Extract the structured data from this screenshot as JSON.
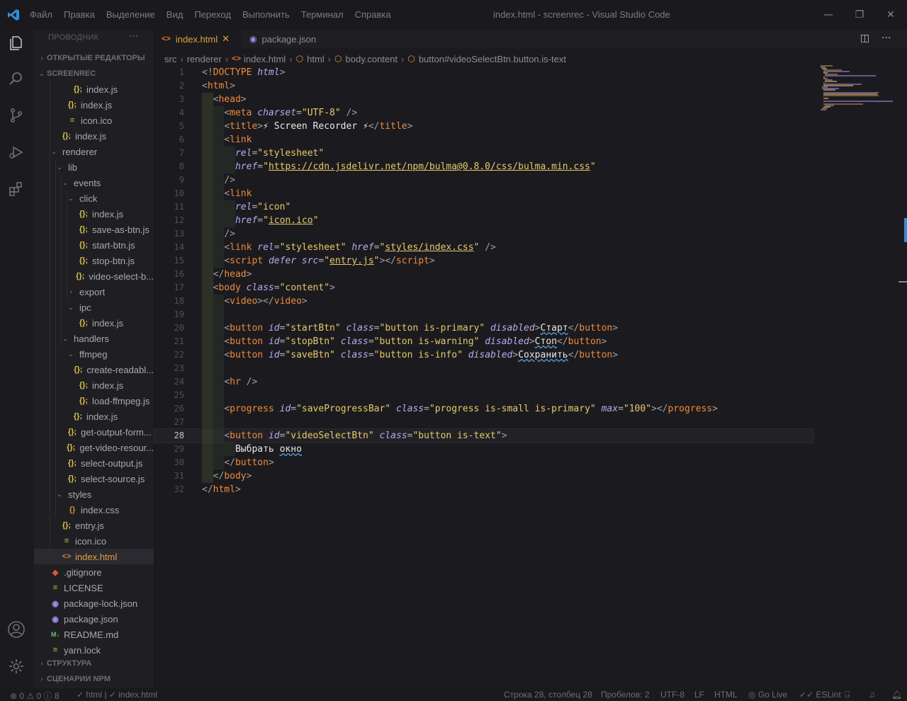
{
  "window": {
    "menu": [
      "Файл",
      "Правка",
      "Выделение",
      "Вид",
      "Переход",
      "Выполнить",
      "Терминал",
      "Справка"
    ],
    "title": "index.html - screenrec - Visual Studio Code"
  },
  "sidebar": {
    "header": "ПРОВОДНИК",
    "more": "···",
    "open_editors": "ОТКРЫТЫЕ РЕДАКТОРЫ",
    "project": "SCREENREC",
    "outline": "СТРУКТУРА",
    "npm_scripts": "СЦЕНАРИИ NPM",
    "tree": [
      {
        "label": "index.js",
        "icon": "js",
        "depth": 5,
        "chev": ""
      },
      {
        "label": "index.js",
        "icon": "js",
        "depth": 4,
        "chev": ""
      },
      {
        "label": "icon.ico",
        "icon": "ico",
        "depth": 4,
        "chev": ""
      },
      {
        "label": "index.js",
        "icon": "js",
        "depth": 3,
        "chev": ""
      },
      {
        "label": "renderer",
        "icon": "",
        "depth": 2,
        "chev": "▾"
      },
      {
        "label": "lib",
        "icon": "",
        "depth": 3,
        "chev": "▾"
      },
      {
        "label": "events",
        "icon": "",
        "depth": 4,
        "chev": "▾"
      },
      {
        "label": "click",
        "icon": "",
        "depth": 5,
        "chev": "▾"
      },
      {
        "label": "index.js",
        "icon": "js",
        "depth": 6,
        "chev": ""
      },
      {
        "label": "save-as-btn.js",
        "icon": "js",
        "depth": 6,
        "chev": ""
      },
      {
        "label": "start-btn.js",
        "icon": "js",
        "depth": 6,
        "chev": ""
      },
      {
        "label": "stop-btn.js",
        "icon": "js",
        "depth": 6,
        "chev": ""
      },
      {
        "label": "video-select-b...",
        "icon": "js",
        "depth": 6,
        "chev": ""
      },
      {
        "label": "export",
        "icon": "",
        "depth": 5,
        "chev": "›"
      },
      {
        "label": "ipc",
        "icon": "",
        "depth": 5,
        "chev": "▾"
      },
      {
        "label": "index.js",
        "icon": "js",
        "depth": 6,
        "chev": ""
      },
      {
        "label": "handlers",
        "icon": "",
        "depth": 4,
        "chev": "▾"
      },
      {
        "label": "ffmpeg",
        "icon": "",
        "depth": 5,
        "chev": "▾"
      },
      {
        "label": "create-readabl...",
        "icon": "js",
        "depth": 6,
        "chev": ""
      },
      {
        "label": "index.js",
        "icon": "js",
        "depth": 6,
        "chev": ""
      },
      {
        "label": "load-ffmpeg.js",
        "icon": "js",
        "depth": 6,
        "chev": ""
      },
      {
        "label": "index.js",
        "icon": "js",
        "depth": 5,
        "chev": ""
      },
      {
        "label": "get-output-form...",
        "icon": "js",
        "depth": 4,
        "chev": ""
      },
      {
        "label": "get-video-resour...",
        "icon": "js",
        "depth": 4,
        "chev": ""
      },
      {
        "label": "select-output.js",
        "icon": "js",
        "depth": 4,
        "chev": ""
      },
      {
        "label": "select-source.js",
        "icon": "js",
        "depth": 4,
        "chev": ""
      },
      {
        "label": "styles",
        "icon": "",
        "depth": 3,
        "chev": "▾"
      },
      {
        "label": "index.css",
        "icon": "css",
        "depth": 4,
        "chev": ""
      },
      {
        "label": "entry.js",
        "icon": "js",
        "depth": 3,
        "chev": ""
      },
      {
        "label": "icon.ico",
        "icon": "ico",
        "depth": 3,
        "chev": ""
      },
      {
        "label": "index.html",
        "icon": "html",
        "depth": 3,
        "chev": "",
        "selected": true
      },
      {
        "label": ".gitignore",
        "icon": "git",
        "depth": 1,
        "chev": ""
      },
      {
        "label": "LICENSE",
        "icon": "lic",
        "depth": 1,
        "chev": ""
      },
      {
        "label": "package-lock.json",
        "icon": "json",
        "depth": 1,
        "chev": ""
      },
      {
        "label": "package.json",
        "icon": "json",
        "depth": 1,
        "chev": ""
      },
      {
        "label": "README.md",
        "icon": "md",
        "depth": 1,
        "chev": ""
      },
      {
        "label": "yarn.lock",
        "icon": "lic",
        "depth": 1,
        "chev": ""
      }
    ]
  },
  "tabs": [
    {
      "label": "index.html",
      "active": true,
      "close": "✕"
    },
    {
      "label": "package.json",
      "active": false
    }
  ],
  "breadcrumb": [
    "src",
    "renderer",
    "index.html",
    "html",
    "body.content",
    "button#videoSelectBtn.button.is-text"
  ],
  "editor": {
    "current_line": 28,
    "lines": [
      [
        [
          "br",
          "<!"
        ],
        [
          "tag",
          "DOCTYPE"
        ],
        [
          "t",
          " "
        ],
        [
          "attr",
          "html"
        ],
        [
          "br",
          ">"
        ]
      ],
      [
        [
          "br",
          "<"
        ],
        [
          "tag",
          "html"
        ],
        [
          "br",
          ">"
        ]
      ],
      [
        [
          "i",
          1
        ],
        [
          "br",
          "<"
        ],
        [
          "tag",
          "head"
        ],
        [
          "br",
          ">"
        ]
      ],
      [
        [
          "i",
          2
        ],
        [
          "br",
          "<"
        ],
        [
          "tag",
          "meta"
        ],
        [
          "t",
          " "
        ],
        [
          "attr",
          "charset"
        ],
        [
          "eq",
          "="
        ],
        [
          "str",
          "\"UTF-8\""
        ],
        [
          "t",
          " "
        ],
        [
          "br",
          "/>"
        ]
      ],
      [
        [
          "i",
          2
        ],
        [
          "br",
          "<"
        ],
        [
          "tag",
          "title"
        ],
        [
          "br",
          ">"
        ],
        [
          "text",
          "⚡ Screen Recorder ⚡"
        ],
        [
          "br",
          "</"
        ],
        [
          "tag",
          "title"
        ],
        [
          "br",
          ">"
        ]
      ],
      [
        [
          "i",
          2
        ],
        [
          "br",
          "<"
        ],
        [
          "tag",
          "link"
        ]
      ],
      [
        [
          "i",
          3
        ],
        [
          "attr",
          "rel"
        ],
        [
          "eq",
          "="
        ],
        [
          "str",
          "\"stylesheet\""
        ]
      ],
      [
        [
          "i",
          3
        ],
        [
          "attr",
          "href"
        ],
        [
          "eq",
          "="
        ],
        [
          "str",
          "\""
        ],
        [
          "link",
          "https://cdn.jsdelivr.net/npm/bulma@0.8.0/css/bulma.min.css"
        ],
        [
          "str",
          "\""
        ]
      ],
      [
        [
          "i",
          2
        ],
        [
          "br",
          "/>"
        ]
      ],
      [
        [
          "i",
          2
        ],
        [
          "br",
          "<"
        ],
        [
          "tag",
          "link"
        ]
      ],
      [
        [
          "i",
          3
        ],
        [
          "attr",
          "rel"
        ],
        [
          "eq",
          "="
        ],
        [
          "str",
          "\"icon\""
        ]
      ],
      [
        [
          "i",
          3
        ],
        [
          "attr",
          "href"
        ],
        [
          "eq",
          "="
        ],
        [
          "str",
          "\""
        ],
        [
          "link",
          "icon.ico"
        ],
        [
          "str",
          "\""
        ]
      ],
      [
        [
          "i",
          2
        ],
        [
          "br",
          "/>"
        ]
      ],
      [
        [
          "i",
          2
        ],
        [
          "br",
          "<"
        ],
        [
          "tag",
          "link"
        ],
        [
          "t",
          " "
        ],
        [
          "attr",
          "rel"
        ],
        [
          "eq",
          "="
        ],
        [
          "str",
          "\"stylesheet\""
        ],
        [
          "t",
          " "
        ],
        [
          "attr",
          "href"
        ],
        [
          "eq",
          "="
        ],
        [
          "str",
          "\""
        ],
        [
          "link",
          "styles/index.css"
        ],
        [
          "str",
          "\""
        ],
        [
          "t",
          " "
        ],
        [
          "br",
          "/>"
        ]
      ],
      [
        [
          "i",
          2
        ],
        [
          "br",
          "<"
        ],
        [
          "tag",
          "script"
        ],
        [
          "t",
          " "
        ],
        [
          "attr",
          "defer"
        ],
        [
          "t",
          " "
        ],
        [
          "attr",
          "src"
        ],
        [
          "eq",
          "="
        ],
        [
          "str",
          "\""
        ],
        [
          "link",
          "entry.js"
        ],
        [
          "str",
          "\""
        ],
        [
          "br",
          "></"
        ],
        [
          "tag",
          "script"
        ],
        [
          "br",
          ">"
        ]
      ],
      [
        [
          "i",
          1
        ],
        [
          "br",
          "</"
        ],
        [
          "tag",
          "head"
        ],
        [
          "br",
          ">"
        ]
      ],
      [
        [
          "i",
          1
        ],
        [
          "br",
          "<"
        ],
        [
          "tag",
          "body"
        ],
        [
          "t",
          " "
        ],
        [
          "attr",
          "class"
        ],
        [
          "eq",
          "="
        ],
        [
          "str",
          "\"content\""
        ],
        [
          "br",
          ">"
        ]
      ],
      [
        [
          "i",
          2
        ],
        [
          "br",
          "<"
        ],
        [
          "tag",
          "video"
        ],
        [
          "br",
          "></"
        ],
        [
          "tag",
          "video"
        ],
        [
          "br",
          ">"
        ]
      ],
      [
        [
          "i",
          2
        ]
      ],
      [
        [
          "i",
          2
        ],
        [
          "br",
          "<"
        ],
        [
          "tag",
          "button"
        ],
        [
          "t",
          " "
        ],
        [
          "attr",
          "id"
        ],
        [
          "eq",
          "="
        ],
        [
          "str",
          "\"startBtn\""
        ],
        [
          "t",
          " "
        ],
        [
          "attr",
          "class"
        ],
        [
          "eq",
          "="
        ],
        [
          "str",
          "\"button is-primary\""
        ],
        [
          "t",
          " "
        ],
        [
          "attr",
          "disabled"
        ],
        [
          "br",
          ">"
        ],
        [
          "sq",
          "Старт"
        ],
        [
          "br",
          "</"
        ],
        [
          "tag",
          "button"
        ],
        [
          "br",
          ">"
        ]
      ],
      [
        [
          "i",
          2
        ],
        [
          "br",
          "<"
        ],
        [
          "tag",
          "button"
        ],
        [
          "t",
          " "
        ],
        [
          "attr",
          "id"
        ],
        [
          "eq",
          "="
        ],
        [
          "str",
          "\"stopBtn\""
        ],
        [
          "t",
          " "
        ],
        [
          "attr",
          "class"
        ],
        [
          "eq",
          "="
        ],
        [
          "str",
          "\"button is-warning\""
        ],
        [
          "t",
          " "
        ],
        [
          "attr",
          "disabled"
        ],
        [
          "br",
          ">"
        ],
        [
          "sq",
          "Стоп"
        ],
        [
          "br",
          "</"
        ],
        [
          "tag",
          "button"
        ],
        [
          "br",
          ">"
        ]
      ],
      [
        [
          "i",
          2
        ],
        [
          "br",
          "<"
        ],
        [
          "tag",
          "button"
        ],
        [
          "t",
          " "
        ],
        [
          "attr",
          "id"
        ],
        [
          "eq",
          "="
        ],
        [
          "str",
          "\"saveBtn\""
        ],
        [
          "t",
          " "
        ],
        [
          "attr",
          "class"
        ],
        [
          "eq",
          "="
        ],
        [
          "str",
          "\"button is-info\""
        ],
        [
          "t",
          " "
        ],
        [
          "attr",
          "disabled"
        ],
        [
          "br",
          ">"
        ],
        [
          "sq",
          "Сохранить"
        ],
        [
          "br",
          "</"
        ],
        [
          "tag",
          "button"
        ],
        [
          "br",
          ">"
        ]
      ],
      [
        [
          "i",
          2
        ]
      ],
      [
        [
          "i",
          2
        ],
        [
          "br",
          "<"
        ],
        [
          "tag",
          "hr"
        ],
        [
          "t",
          " "
        ],
        [
          "br",
          "/>"
        ]
      ],
      [
        [
          "i",
          2
        ]
      ],
      [
        [
          "i",
          2
        ],
        [
          "br",
          "<"
        ],
        [
          "tag",
          "progress"
        ],
        [
          "t",
          " "
        ],
        [
          "attr",
          "id"
        ],
        [
          "eq",
          "="
        ],
        [
          "str",
          "\"saveProgressBar\""
        ],
        [
          "t",
          " "
        ],
        [
          "attr",
          "class"
        ],
        [
          "eq",
          "="
        ],
        [
          "str",
          "\"progress is-small is-primary\""
        ],
        [
          "t",
          " "
        ],
        [
          "attr",
          "max"
        ],
        [
          "eq",
          "="
        ],
        [
          "str",
          "\"100\""
        ],
        [
          "br",
          "></"
        ],
        [
          "tag",
          "progress"
        ],
        [
          "br",
          ">"
        ]
      ],
      [
        [
          "i",
          2
        ]
      ],
      [
        [
          "i",
          2
        ],
        [
          "br",
          "<"
        ],
        [
          "tag",
          "button"
        ],
        [
          "t",
          " "
        ],
        [
          "attr",
          "id"
        ],
        [
          "eq",
          "="
        ],
        [
          "str",
          "\"videoSelectBtn\""
        ],
        [
          "t",
          " "
        ],
        [
          "attr",
          "class"
        ],
        [
          "eq",
          "="
        ],
        [
          "str",
          "\"button is-text\""
        ],
        [
          "br",
          ">"
        ]
      ],
      [
        [
          "i",
          3
        ],
        [
          "text",
          "Выбрать "
        ],
        [
          "sq",
          "окно"
        ]
      ],
      [
        [
          "i",
          2
        ],
        [
          "br",
          "</"
        ],
        [
          "tag",
          "button"
        ],
        [
          "br",
          ">"
        ]
      ],
      [
        [
          "i",
          1
        ],
        [
          "br",
          "</"
        ],
        [
          "tag",
          "body"
        ],
        [
          "br",
          ">"
        ]
      ],
      [
        [
          "br",
          "</"
        ],
        [
          "tag",
          "html"
        ],
        [
          "br",
          ">"
        ]
      ]
    ]
  },
  "statusbar": {
    "errors": "0",
    "warnings": "0",
    "info": "8",
    "html_check": "✓ html | ✓ index.html",
    "position": "Строка 28, столбец 28",
    "spaces": "Пробелов: 2",
    "encoding": "UTF-8",
    "eol": "LF",
    "language": "HTML",
    "golive": "Go Live",
    "eslint": "ESLint"
  },
  "colors": {
    "accent_tab": "#e0a040",
    "tag": "#f08a3a",
    "attr": "#bba8f0",
    "string": "#e8c96a"
  }
}
